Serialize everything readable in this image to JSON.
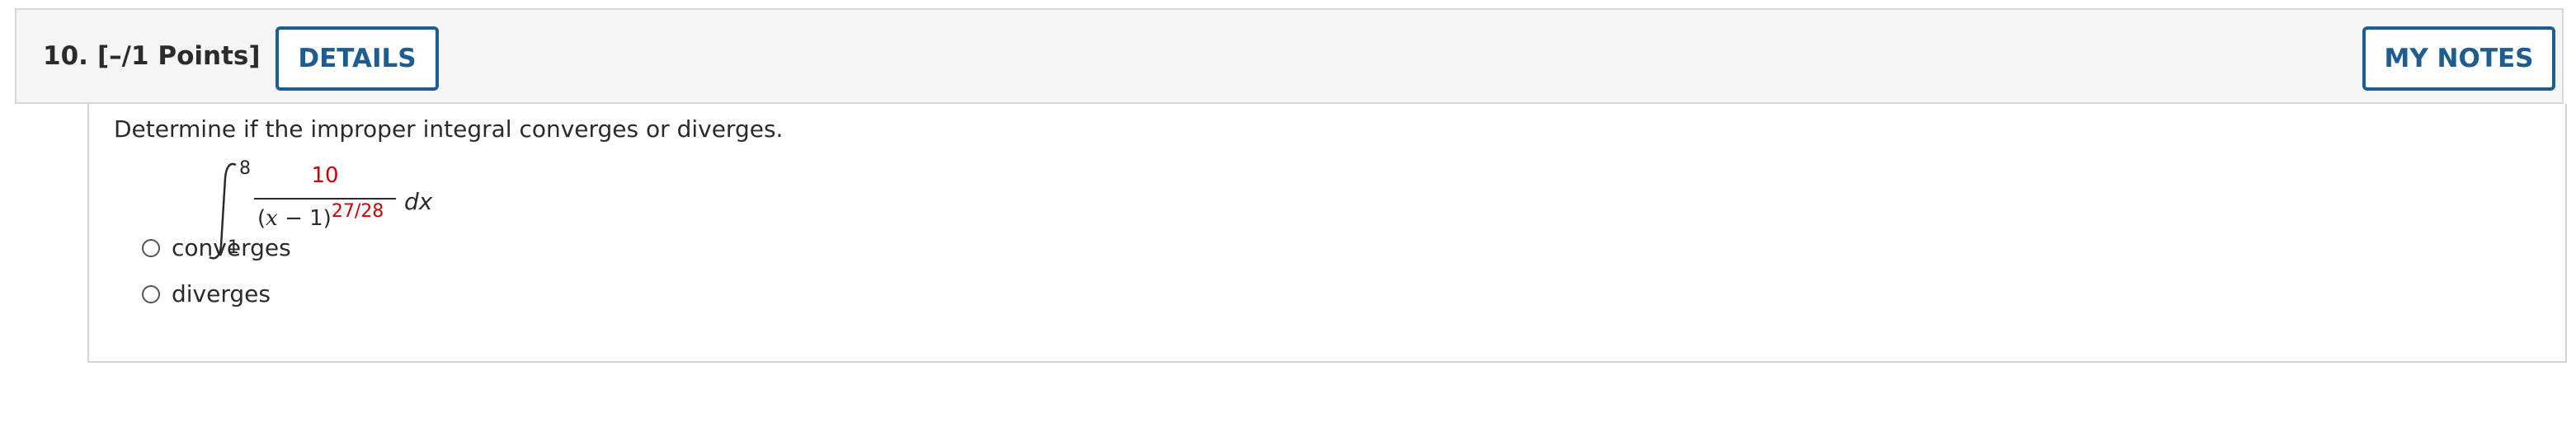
{
  "question": {
    "number": "10.",
    "points": "[–/1 Points]"
  },
  "header": {
    "details_label": "DETAILS",
    "my_notes_label": "MY NOTES"
  },
  "prompt": "Determine if the improper integral converges or diverges.",
  "integral": {
    "upper_limit": "8",
    "lower_limit": "1",
    "numerator": "10",
    "denominator_open": "(",
    "denominator_var": "x",
    "denominator_rest": " − 1)",
    "exponent": "27/28",
    "differential": "dx"
  },
  "options": [
    {
      "label": "converges"
    },
    {
      "label": "diverges"
    }
  ],
  "colors": {
    "accent": "#1d5d90",
    "highlight": "#cc0000"
  }
}
